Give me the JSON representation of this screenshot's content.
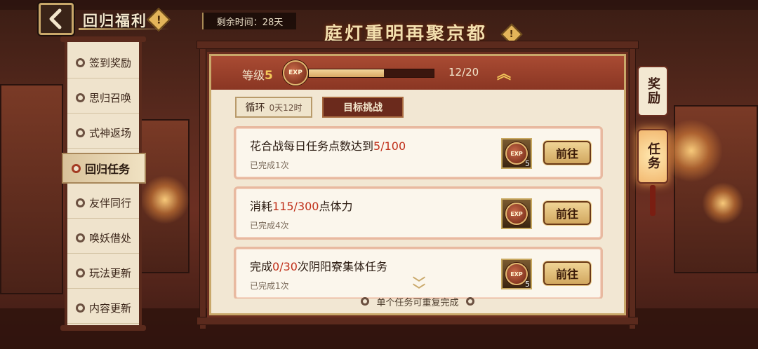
{
  "header": {
    "back_icon": "back-arrow-icon",
    "title": "回归福利",
    "info_icon": "!",
    "timer": "剩余时间：28天",
    "event_title": "庭灯重明再聚京都",
    "event_info_icon": "!"
  },
  "sidebar": {
    "items": [
      {
        "label": "签到奖励",
        "active": false
      },
      {
        "label": "思归召唤",
        "active": false
      },
      {
        "label": "式神返场",
        "active": false
      },
      {
        "label": "回归任务",
        "active": true
      },
      {
        "label": "友伴同行",
        "active": false
      },
      {
        "label": "唤妖借处",
        "active": false
      },
      {
        "label": "玩法更新",
        "active": false
      },
      {
        "label": "内容更新",
        "active": false
      }
    ]
  },
  "level": {
    "label": "等级",
    "value": "5",
    "badge": "EXP",
    "progress_text": "12/20",
    "progress_fraction": 0.6,
    "collapse_icon": "double-chevron-up-icon"
  },
  "tabs": {
    "cycle_label": "循环",
    "cycle_time": "0天12时",
    "goal_label": "目标挑战"
  },
  "tasks": [
    {
      "title_pre": "花合战每日任务点数达到",
      "title_hl": "5/100",
      "title_post": "",
      "sub": "已完成1次",
      "reward_badge": "EXP",
      "reward_count": "5",
      "button": "前往"
    },
    {
      "title_pre": "消耗",
      "title_hl": "115/300",
      "title_post": "点体力",
      "sub": "已完成4次",
      "reward_badge": "EXP",
      "reward_count": "",
      "button": "前往"
    },
    {
      "title_pre": "完成",
      "title_hl": "0/30",
      "title_post": "次阴阳寮集体任务",
      "sub": "已完成1次",
      "reward_badge": "EXP",
      "reward_count": "5",
      "button": "前往"
    }
  ],
  "footer_note": "单个任务可重复完成",
  "side_tabs": [
    {
      "label": "奖励",
      "active": false
    },
    {
      "label": "任务",
      "active": true
    }
  ],
  "colors": {
    "accent": "#c0301a",
    "gold": "#f3c85a",
    "panel": "#f2e7d3",
    "frame": "#6b2f20"
  }
}
